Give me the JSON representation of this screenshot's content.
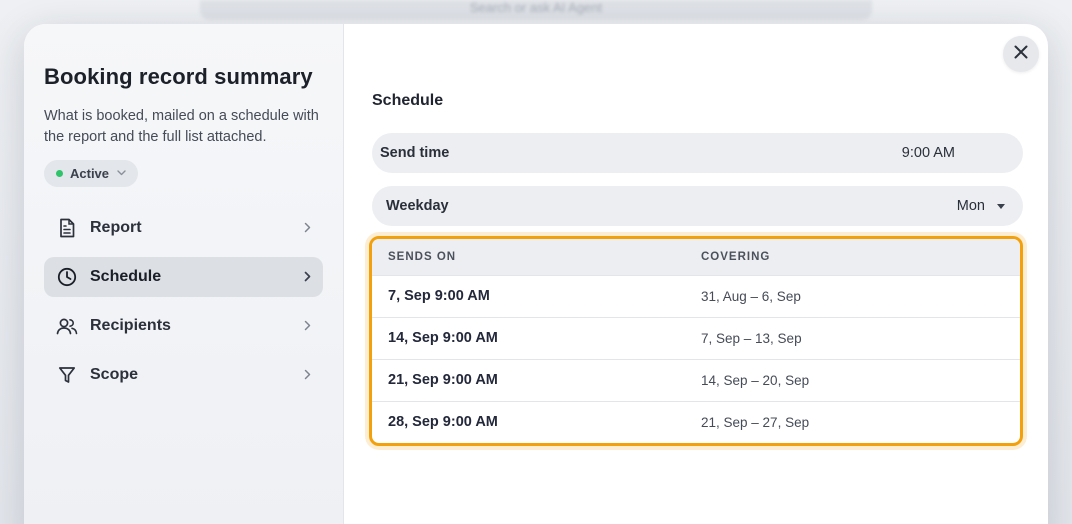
{
  "backdrop": {
    "search_placeholder": "Search or ask AI Agent"
  },
  "sidebar": {
    "title": "Booking record summary",
    "description": "What is booked, mailed on a schedule with the report and the full list attached.",
    "status": {
      "label": "Active",
      "color": "#2fc36a"
    },
    "items": [
      {
        "label": "Report",
        "icon": "document-icon",
        "active": false
      },
      {
        "label": "Schedule",
        "icon": "clock-icon",
        "active": true
      },
      {
        "label": "Recipients",
        "icon": "users-icon",
        "active": false
      },
      {
        "label": "Scope",
        "icon": "filter-icon",
        "active": false
      }
    ]
  },
  "main": {
    "section_title": "Schedule",
    "send_time": {
      "label": "Send time",
      "value": "9:00 AM"
    },
    "weekday": {
      "label": "Weekday",
      "value": "Mon"
    },
    "table": {
      "headers": [
        "SENDS ON",
        "COVERING"
      ],
      "rows": [
        {
          "sends_on": "7, Sep 9:00 AM",
          "covering": "31, Aug – 6, Sep"
        },
        {
          "sends_on": "14, Sep 9:00 AM",
          "covering": "7, Sep – 13, Sep"
        },
        {
          "sends_on": "21, Sep 9:00 AM",
          "covering": "14, Sep – 20, Sep"
        },
        {
          "sends_on": "28, Sep 9:00 AM",
          "covering": "21, Sep – 27, Sep"
        }
      ],
      "highlight_color": "#f2a10c"
    }
  }
}
